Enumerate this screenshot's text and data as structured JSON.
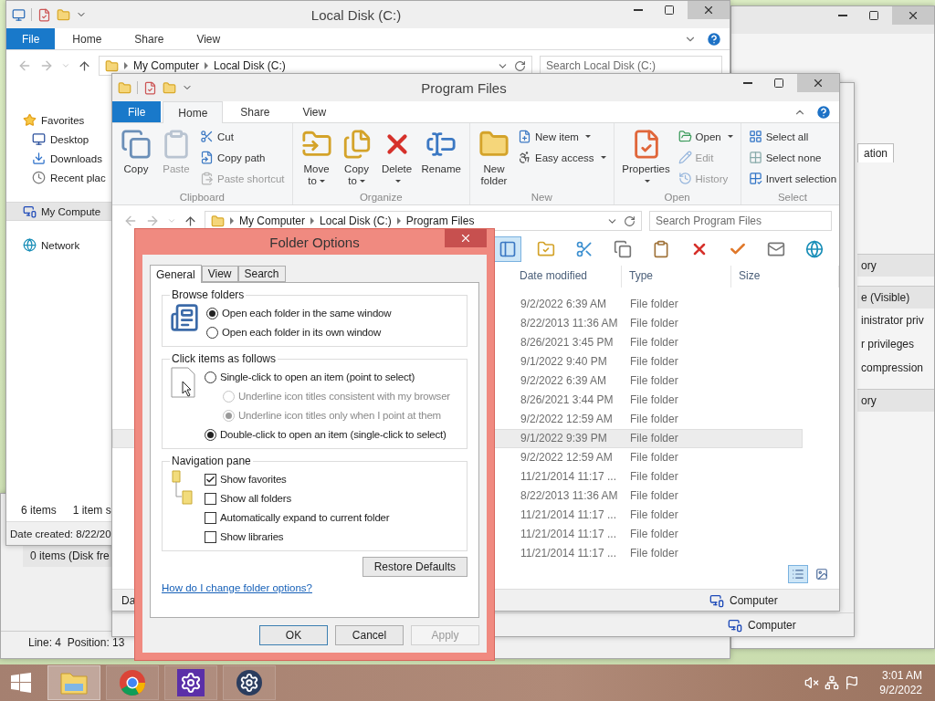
{
  "right_window": {
    "tab_label": "ation",
    "rows": [
      {
        "kind": "header",
        "text": "ory"
      },
      {
        "kind": "header",
        "text": "e (Visible)"
      },
      {
        "kind": "text",
        "text": "inistrator priv"
      },
      {
        "kind": "text",
        "text": "r privileges"
      },
      {
        "kind": "text",
        "text": "compression"
      },
      {
        "kind": "header",
        "text": "ory"
      }
    ]
  },
  "lower_window": {
    "status_text": "0 items (Disk fre",
    "position": "Line: 4  Position: 13"
  },
  "middle_window": {
    "status_text": "Computer"
  },
  "local_disk_window": {
    "title": "Local Disk (C:)",
    "tabs": [
      {
        "label": "File",
        "kind": "file",
        "selected": false
      },
      {
        "label": "Home",
        "kind": "tab",
        "selected": false
      },
      {
        "label": "Share",
        "kind": "tab",
        "selected": false
      },
      {
        "label": "View",
        "kind": "tab",
        "selected": false
      }
    ],
    "address": [
      "My Computer",
      "Local Disk (C:)"
    ],
    "search": {
      "placeholder": "Search Local Disk (C:)"
    },
    "nav_items": [
      {
        "label": "Favorites",
        "kind": "favorites",
        "selected": false,
        "children": [
          {
            "label": "Desktop",
            "kind": "desktop",
            "selected": false
          },
          {
            "label": "Downloads",
            "kind": "downloads",
            "selected": false
          },
          {
            "label": "Recent plac",
            "kind": "recent",
            "selected": false
          }
        ]
      },
      {
        "label": "My Compute",
        "kind": "computer",
        "selected": true
      },
      {
        "label": "Network",
        "kind": "network",
        "selected": false
      }
    ],
    "status": [
      "6 items",
      "1 item s"
    ],
    "details": "Date created: 8/22/20"
  },
  "program_files_window": {
    "title": "Program Files",
    "tabs": [
      {
        "label": "File",
        "kind": "file",
        "selected": false
      },
      {
        "label": "Home",
        "kind": "tab",
        "selected": true
      },
      {
        "label": "Share",
        "kind": "tab",
        "selected": false
      },
      {
        "label": "View",
        "kind": "tab",
        "selected": false
      }
    ],
    "ribbon": [
      {
        "label": "Clipboard",
        "large": [
          {
            "kind": "copy",
            "label": "Copy",
            "disabled": false,
            "dropdown": false
          },
          {
            "kind": "paste",
            "label": "Paste",
            "disabled": true,
            "dropdown": false
          }
        ],
        "small": [
          {
            "kind": "cut",
            "label": "Cut",
            "disabled": false,
            "dropdown": false
          },
          {
            "kind": "copy-path",
            "label": "Copy path",
            "disabled": false,
            "dropdown": false
          },
          {
            "kind": "paste-shortcut",
            "label": "Paste shortcut",
            "disabled": true,
            "dropdown": false
          }
        ]
      },
      {
        "label": "Organize",
        "large": [
          {
            "kind": "move",
            "label": "Move to",
            "disabled": false,
            "dropdown": true
          },
          {
            "kind": "copy-to",
            "label": "Copy to",
            "disabled": false,
            "dropdown": true
          },
          {
            "kind": "delete",
            "label": "Delete",
            "disabled": false,
            "dropdown": true
          },
          {
            "kind": "rename",
            "label": "Rename",
            "disabled": false,
            "dropdown": false
          }
        ]
      },
      {
        "label": "New",
        "large": [
          {
            "kind": "folder",
            "label": "New folder",
            "disabled": false,
            "dropdown": false
          }
        ],
        "small": [
          {
            "kind": "new-item",
            "label": "New item",
            "disabled": false,
            "dropdown": true
          },
          {
            "kind": "easy-access",
            "label": "Easy access",
            "disabled": false,
            "dropdown": true
          }
        ]
      },
      {
        "label": "Open",
        "large": [
          {
            "kind": "properties",
            "label": "Properties",
            "disabled": false,
            "dropdown": true
          }
        ],
        "small": [
          {
            "kind": "open",
            "label": "Open",
            "disabled": false,
            "dropdown": true
          },
          {
            "kind": "edit",
            "label": "Edit",
            "disabled": true,
            "dropdown": false
          },
          {
            "kind": "history",
            "label": "History",
            "disabled": true,
            "dropdown": false
          }
        ]
      },
      {
        "label": "Select",
        "small": [
          {
            "kind": "select-all",
            "label": "Select all",
            "disabled": false,
            "dropdown": false
          },
          {
            "kind": "select-none",
            "label": "Select none",
            "disabled": false,
            "dropdown": false
          },
          {
            "kind": "invert",
            "label": "Invert selection",
            "disabled": false,
            "dropdown": false
          }
        ]
      }
    ],
    "address": [
      "My Computer",
      "Local Disk (C:)",
      "Program Files"
    ],
    "search": {
      "placeholder": "Search Program Files"
    },
    "toolbar": [
      {
        "kind": "pane",
        "selected": true
      },
      {
        "kind": "folder-check",
        "selected": false
      },
      {
        "kind": "cut",
        "selected": false
      },
      {
        "kind": "copy",
        "selected": false
      },
      {
        "kind": "paste",
        "selected": false
      },
      {
        "kind": "delete",
        "selected": false
      },
      {
        "kind": "check",
        "selected": false
      },
      {
        "kind": "mail",
        "selected": false
      },
      {
        "kind": "globe",
        "selected": false
      }
    ],
    "columns": [
      "Date modified",
      "Type",
      "Size"
    ],
    "rows": [
      {
        "date": "9/2/2022 6:39 AM",
        "type": "File folder",
        "selected": false
      },
      {
        "date": "8/22/2013 11:36 AM",
        "type": "File folder",
        "selected": false
      },
      {
        "date": "8/26/2021 3:45 PM",
        "type": "File folder",
        "selected": false
      },
      {
        "date": "9/1/2022 9:40 PM",
        "type": "File folder",
        "selected": false
      },
      {
        "date": "9/2/2022 6:39 AM",
        "type": "File folder",
        "selected": false
      },
      {
        "date": "8/26/2021 3:44 PM",
        "type": "File folder",
        "selected": false
      },
      {
        "date": "9/2/2022 12:59 AM",
        "type": "File folder",
        "selected": false
      },
      {
        "date": "9/1/2022 9:39 PM",
        "type": "File folder",
        "selected": true
      },
      {
        "date": "9/2/2022 12:59 AM",
        "type": "File folder",
        "selected": false
      },
      {
        "date": "11/21/2014 11:17 ...",
        "type": "File folder",
        "selected": false
      },
      {
        "date": "8/22/2013 11:36 AM",
        "type": "File folder",
        "selected": false
      },
      {
        "date": "11/21/2014 11:17 ...",
        "type": "File folder",
        "selected": false
      },
      {
        "date": "11/21/2014 11:17 ...",
        "type": "File folder",
        "selected": false
      },
      {
        "date": "11/21/2014 11:17 ...",
        "type": "File folder",
        "selected": false
      }
    ],
    "view_buttons": [
      {
        "kind": "details",
        "selected": true
      },
      {
        "kind": "large-icons",
        "selected": false
      }
    ],
    "status": [
      "Da",
      "Computer"
    ]
  },
  "folder_options": {
    "title": "Folder Options",
    "tabs": [
      {
        "label": "General",
        "selected": true
      },
      {
        "label": "View",
        "selected": false
      },
      {
        "label": "Search",
        "selected": false
      }
    ],
    "browse": {
      "legend": "Browse folders",
      "options": [
        {
          "label": "Open each folder in the same window",
          "selected": true
        },
        {
          "label": "Open each folder in its own window",
          "selected": false
        }
      ]
    },
    "click": {
      "legend": "Click items as follows",
      "options": [
        {
          "kind": "main",
          "label": "Single-click to open an item (point to select)",
          "selected": false,
          "disabled": false
        },
        {
          "kind": "sub",
          "label": "Underline icon titles consistent with my browser",
          "selected": false,
          "disabled": true
        },
        {
          "kind": "sub",
          "label": "Underline icon titles only when I point at them",
          "selected": true,
          "disabled": true
        },
        {
          "kind": "main",
          "label": "Double-click to open an item (single-click to select)",
          "selected": true,
          "disabled": false
        }
      ]
    },
    "navigation": {
      "legend": "Navigation pane",
      "options": [
        {
          "label": "Show favorites",
          "checked": true
        },
        {
          "label": "Show all folders",
          "checked": false
        },
        {
          "label": "Automatically expand to current folder",
          "checked": false
        },
        {
          "label": "Show libraries",
          "checked": false
        }
      ]
    },
    "restore": "Restore Defaults",
    "help_link": "How do I change folder options?",
    "buttons": [
      {
        "label": "OK",
        "default": true,
        "disabled": false
      },
      {
        "label": "Cancel",
        "default": false,
        "disabled": false
      },
      {
        "label": "Apply",
        "default": false,
        "disabled": true
      }
    ]
  },
  "taskbar": {
    "apps": [
      {
        "kind": "explorer",
        "selected": true
      },
      {
        "kind": "chrome",
        "selected": false
      },
      {
        "kind": "settings-tile",
        "selected": false
      },
      {
        "kind": "settings-round",
        "selected": false
      }
    ],
    "time": "3:01 AM",
    "date": "9/2/2022"
  }
}
